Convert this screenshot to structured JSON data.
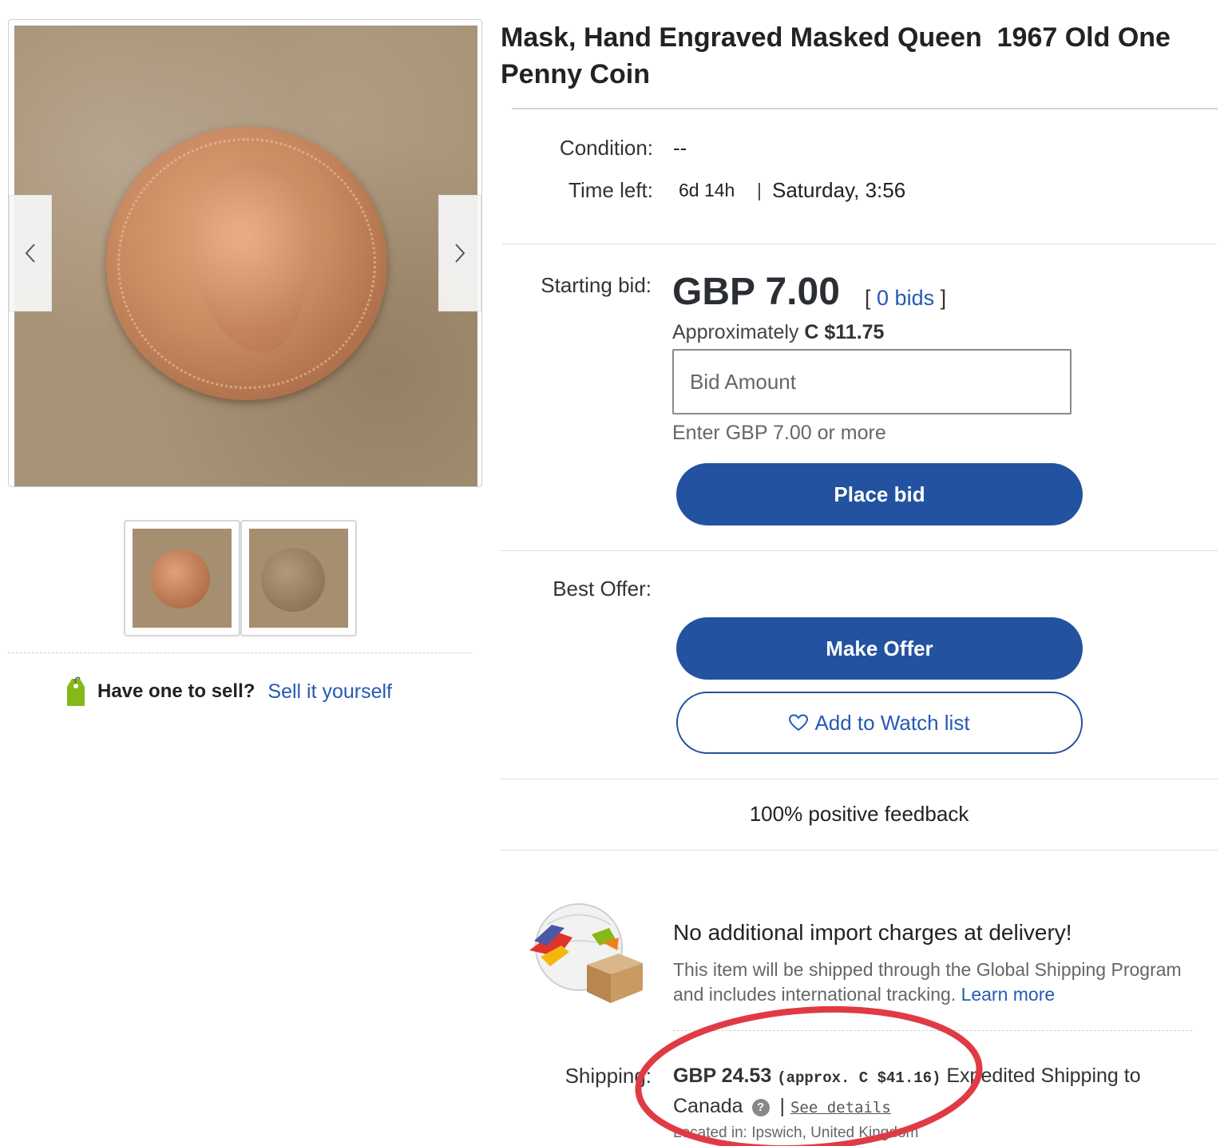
{
  "listing": {
    "title": "Mask, Hand Engraved Masked Queen  1967 Old One Penny Coin"
  },
  "gallery": {
    "prev_label": "previous image",
    "next_label": "next image",
    "thumbnail_count": 2
  },
  "sell": {
    "question": "Have one to sell?",
    "link": "Sell it yourself"
  },
  "details": {
    "condition_label": "Condition:",
    "condition_value": "--",
    "time_left_label": "Time left:",
    "time_left_value": "6d 14h",
    "separator": "|",
    "end_time": "Saturday, 3:56"
  },
  "bidding": {
    "starting_bid_label": "Starting bid:",
    "price": "GBP 7.00",
    "bids_open": "[",
    "bids_link": "0 bids",
    "bids_close": "]",
    "approx_prefix": "Approximately",
    "approx_value": "C $11.75",
    "input_placeholder": "Bid Amount",
    "hint": "Enter GBP 7.00 or more",
    "place_bid_button": "Place bid"
  },
  "offer": {
    "label": "Best Offer:",
    "make_offer_button": "Make Offer",
    "watch_button": "Add to Watch list"
  },
  "seller": {
    "feedback": "100% positive feedback"
  },
  "gsp": {
    "title": "No additional import charges at delivery!",
    "description": "This item will be shipped through the Global Shipping Program and includes international tracking.",
    "learn_more": "Learn more"
  },
  "shipping": {
    "label": "Shipping:",
    "price": "GBP 24.53",
    "approx": "(approx. C $41.16)",
    "method": "Expedited Shipping to Canada",
    "divider": "|",
    "see_details": "See details",
    "located": "Located in: Ipswich, United Kingdom"
  },
  "colors": {
    "primary_button": "#2252a0",
    "link": "#2659b5",
    "annotation": "#e03b45"
  }
}
